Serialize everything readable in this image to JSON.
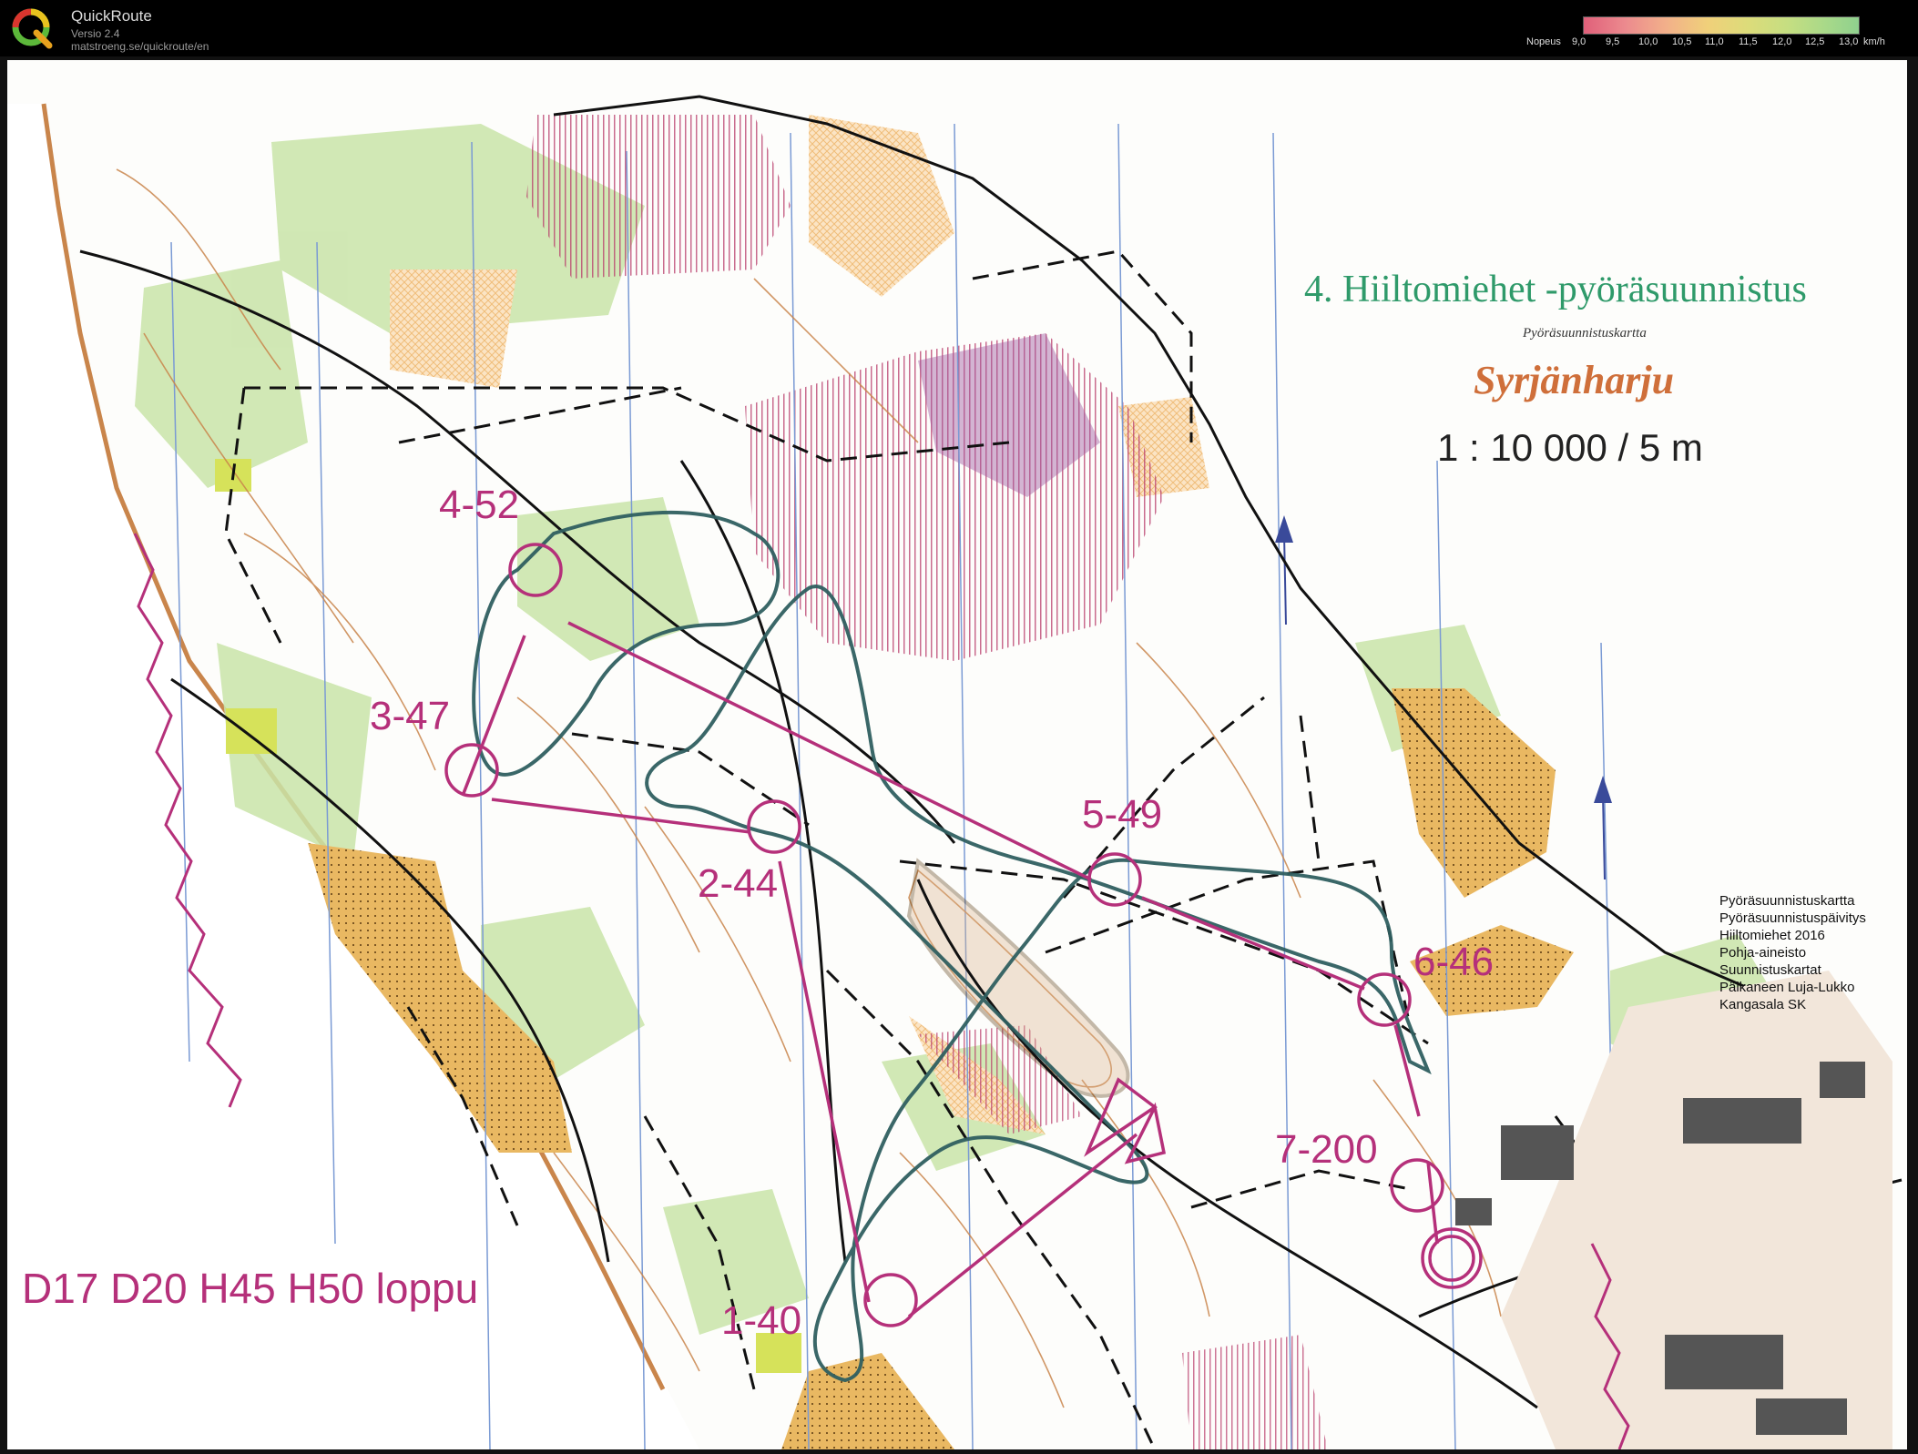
{
  "app": {
    "title": "QuickRoute",
    "version": "Versio 2.4",
    "url": "matstroeng.se/quickroute/en"
  },
  "speed_legend": {
    "label": "Nopeus",
    "ticks": [
      "9,0",
      "9,5",
      "10,0",
      "10,5",
      "11,0",
      "11,5",
      "12,0",
      "12,5",
      "13,0"
    ],
    "unit": "km/h",
    "range_kmh": [
      9.0,
      13.0
    ]
  },
  "map": {
    "event_title": "4. Hiiltomiehet -pyöräsuunnistus",
    "map_type": "Pyöräsuunnistuskartta",
    "map_name": "Syrjänharju",
    "scale": "1 : 10 000   / 5 m",
    "credits": [
      "Pyöräsuunnistuskartta",
      "Pyöräsuunnistuspäivitys",
      "Hiiltomiehet 2016",
      "Pohja-aineisto",
      "Suunnistuskartat",
      "Pälkaneen Luja-Lukko",
      "Kangasala SK"
    ],
    "class_label": "D17 D20 H45 H50 loppu",
    "controls": [
      {
        "label": "1-40"
      },
      {
        "label": "2-44"
      },
      {
        "label": "3-47"
      },
      {
        "label": "4-52"
      },
      {
        "label": "5-49"
      },
      {
        "label": "6-46"
      },
      {
        "label": "7-200"
      }
    ],
    "colors": {
      "course": "#b5307a",
      "route": "#2f5f60",
      "open_land": "#e9b862",
      "vegetation": "#c9e4a8",
      "contours": "#c9854b",
      "restricted": "#b83a6a",
      "magnetic_north": "#3a4a9a"
    }
  }
}
